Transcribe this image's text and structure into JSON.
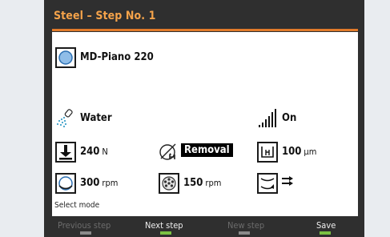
{
  "title": "Steel – Step No. 1",
  "disc": {
    "name": "MD-Piano 220"
  },
  "lubricant": {
    "label": "Water"
  },
  "dosing": {
    "label": "On"
  },
  "force": {
    "value": "240",
    "unit": "N"
  },
  "mode": {
    "label": "Removal"
  },
  "removal_amount": {
    "value": "100",
    "unit": "µm"
  },
  "disc_speed": {
    "value": "300",
    "unit": "rpm"
  },
  "holder_speed": {
    "value": "150",
    "unit": "rpm"
  },
  "hint": "Select mode",
  "footer": {
    "buttons": [
      {
        "label": "Previous step",
        "enabled": false
      },
      {
        "label": "Next step",
        "enabled": true
      },
      {
        "label": "New step",
        "enabled": false
      },
      {
        "label": "Save",
        "enabled": true
      }
    ]
  },
  "colors": {
    "title": "#f5a34a",
    "accent": "#e07a2a",
    "enabled_marker": "#7ac142",
    "disabled_marker": "#8a8a8a",
    "disc_icon": "#5b9bd5"
  }
}
